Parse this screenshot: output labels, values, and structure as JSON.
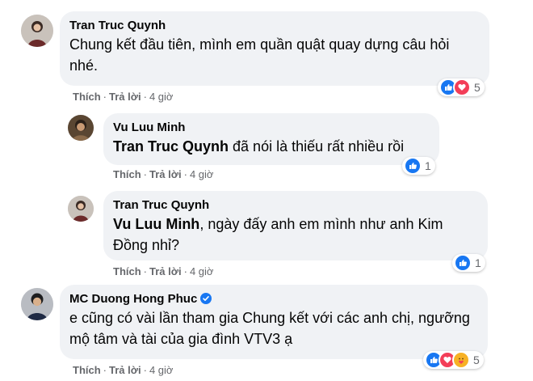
{
  "comments": [
    {
      "author": "Tran Truc Quynh",
      "text": "Chung kết đầu tiên, mình em quần quật quay dựng câu hỏi nhé.",
      "actions": {
        "like": "Thích",
        "reply": "Trả lời",
        "time": "4 giờ"
      },
      "reactions": {
        "types": [
          "like-icon",
          "love-icon"
        ],
        "count": "5"
      }
    },
    {
      "author": "Vu Luu Minh",
      "mention": "Tran Truc Quynh",
      "text": " đã nói là thiếu rất nhiều rồi",
      "actions": {
        "like": "Thích",
        "reply": "Trả lời",
        "time": "4 giờ"
      },
      "reactions": {
        "types": [
          "like-icon"
        ],
        "count": "1"
      }
    },
    {
      "author": "Tran Truc Quynh",
      "mention": "Vu Luu Minh",
      "text": ", ngày đấy anh em mình như anh Kim Đồng nhỉ?",
      "actions": {
        "like": "Thích",
        "reply": "Trả lời",
        "time": "4 giờ"
      },
      "reactions": {
        "types": [
          "like-icon"
        ],
        "count": "1"
      }
    },
    {
      "author": "MC Duong Hong Phuc",
      "verified": true,
      "text": "e cũng có vài lần tham gia Chung kết với các anh chị, ngưỡng mộ tâm và tài của gia đình VTV3 ạ",
      "actions": {
        "like": "Thích",
        "reply": "Trả lời",
        "time": "4 giờ"
      },
      "reactions": {
        "types": [
          "like-icon",
          "love-icon",
          "care-icon"
        ],
        "count": "5"
      }
    }
  ],
  "colors": {
    "bubble": "#f0f2f5",
    "meta_text": "#65676b",
    "like": "#1877f2",
    "love": "#f33e58",
    "care": "#f7b125"
  }
}
